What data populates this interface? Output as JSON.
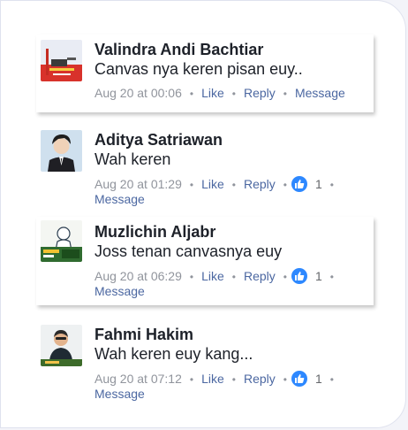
{
  "comments": [
    {
      "author": "Valindra Andi Bachtiar",
      "text": "Canvas nya keren pisan euy..",
      "time": "Aug 20 at 00:06",
      "like_label": "Like",
      "reply_label": "Reply",
      "message_label": "Message",
      "reactions": null,
      "avatar_icon": "profile-photo-icon"
    },
    {
      "author": "Aditya Satriawan",
      "text": "Wah keren",
      "time": "Aug 20 at 01:29",
      "like_label": "Like",
      "reply_label": "Reply",
      "message_label": "Message",
      "reactions": "1",
      "avatar_icon": "profile-photo-icon"
    },
    {
      "author": "Muzlichin Aljabr",
      "text": "Joss tenan canvasnya euy",
      "time": "Aug 20 at 06:29",
      "like_label": "Like",
      "reply_label": "Reply",
      "message_label": "Message",
      "reactions": "1",
      "avatar_icon": "profile-photo-icon"
    },
    {
      "author": "Fahmi Hakim",
      "text": "Wah keren euy kang...",
      "time": "Aug 20 at 07:12",
      "like_label": "Like",
      "reply_label": "Reply",
      "message_label": "Message",
      "reactions": "1",
      "avatar_icon": "profile-photo-icon"
    }
  ],
  "colors": {
    "name": "#1d2129",
    "link": "#4b67a1",
    "meta": "#90949c",
    "like_badge": "#2d88ff"
  },
  "reaction_icon": "thumbs-up-icon"
}
